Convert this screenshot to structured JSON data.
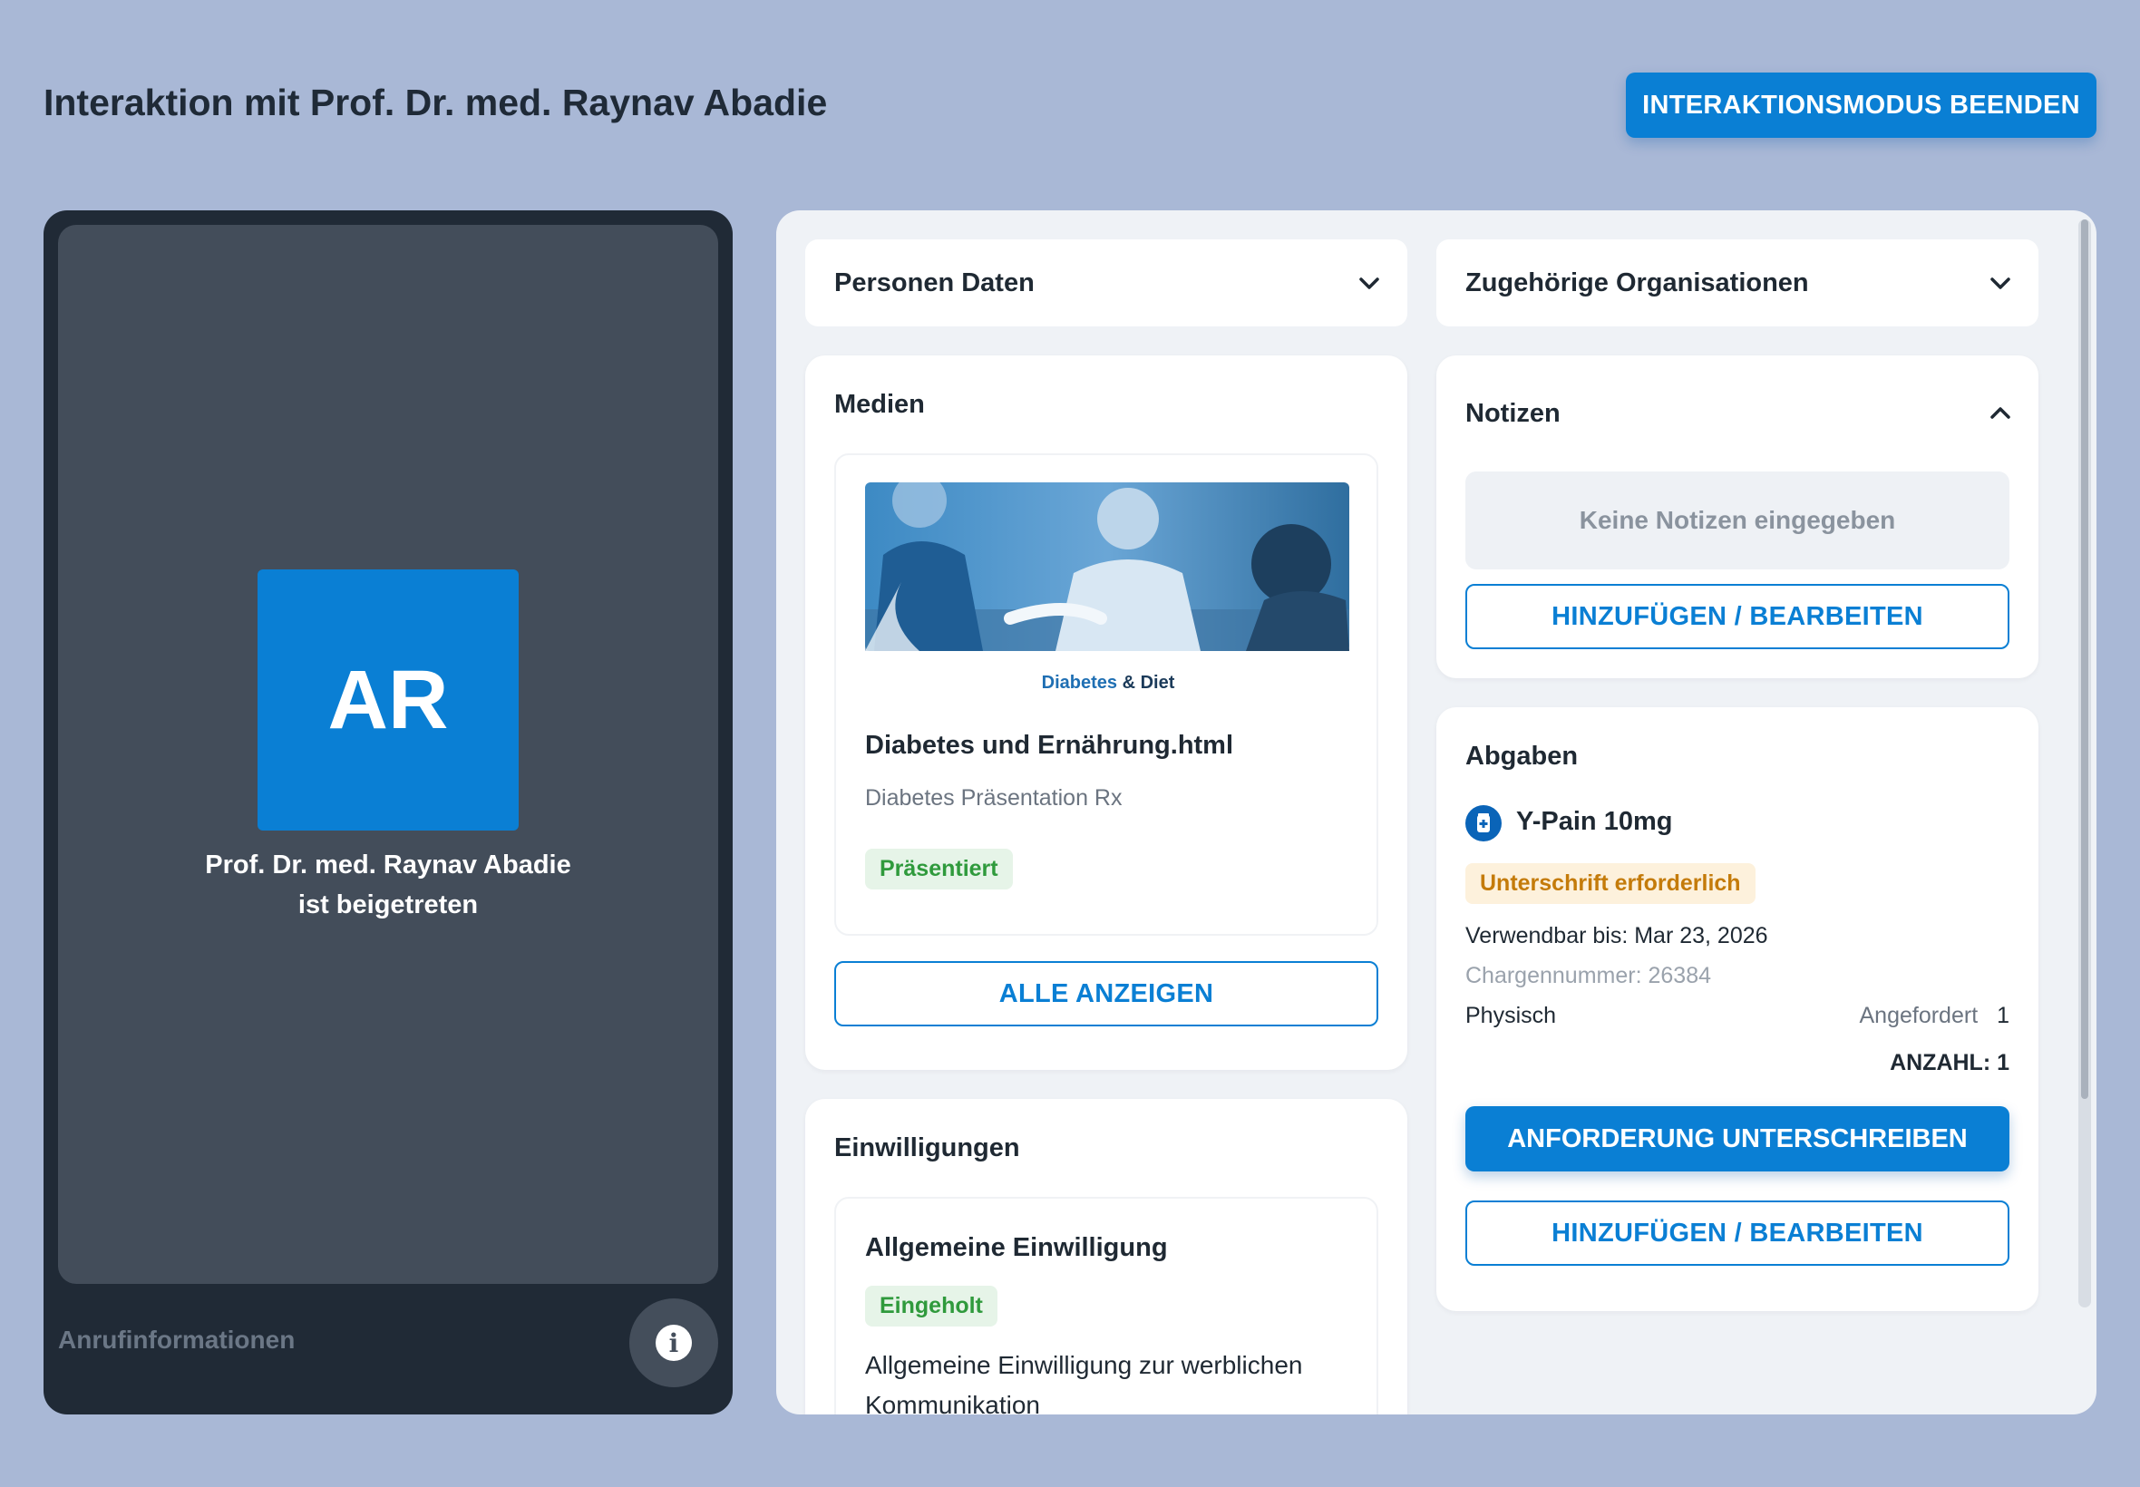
{
  "header": {
    "title": "Interaktion mit Prof. Dr. med. Raynav Abadie",
    "end_button": "INTERAKTIONSMODUS BEENDEN"
  },
  "video": {
    "initials": "AR",
    "joined_text": "Prof. Dr. med. Raynav Abadie ist beigetreten",
    "call_info_label": "Anrufinformationen"
  },
  "sections": {
    "personen_daten": "Personen Daten",
    "organisationen": "Zugehörige Organisationen"
  },
  "medien": {
    "title": "Medien",
    "item": {
      "thumb_caption_a": "Diabetes",
      "thumb_caption_b": " & Diet",
      "name": "Diabetes und Ernährung.html",
      "subtitle": "Diabetes Präsentation Rx",
      "badge": "Präsentiert"
    },
    "show_all": "ALLE ANZEIGEN"
  },
  "notizen": {
    "title": "Notizen",
    "empty": "Keine Notizen eingegeben",
    "edit_button": "HINZUFÜGEN / BEARBEITEN"
  },
  "abgaben": {
    "title": "Abgaben",
    "product": "Y-Pain 10mg",
    "badge": "Unterschrift erforderlich",
    "expiry": "Verwendbar bis: Mar 23, 2026",
    "lot": "Chargennummer: 26384",
    "type": "Physisch",
    "requested_label": "Angefordert",
    "requested_value": "1",
    "count": "ANZAHL: 1",
    "sign_button": "ANFORDERUNG UNTERSCHREIBEN",
    "edit_button": "HINZUFÜGEN / BEARBEITEN"
  },
  "einwilligungen": {
    "title": "Einwilligungen",
    "item_title": "Allgemeine Einwilligung",
    "badge": "Eingeholt",
    "description": "Allgemeine Einwilligung zur werblichen Kommunikation"
  },
  "colors": {
    "primary": "#0a7fd4",
    "background": "#a9b8d6",
    "video_panel": "#202a36",
    "success": "#2f9a3c",
    "warning": "#c47b0a"
  }
}
